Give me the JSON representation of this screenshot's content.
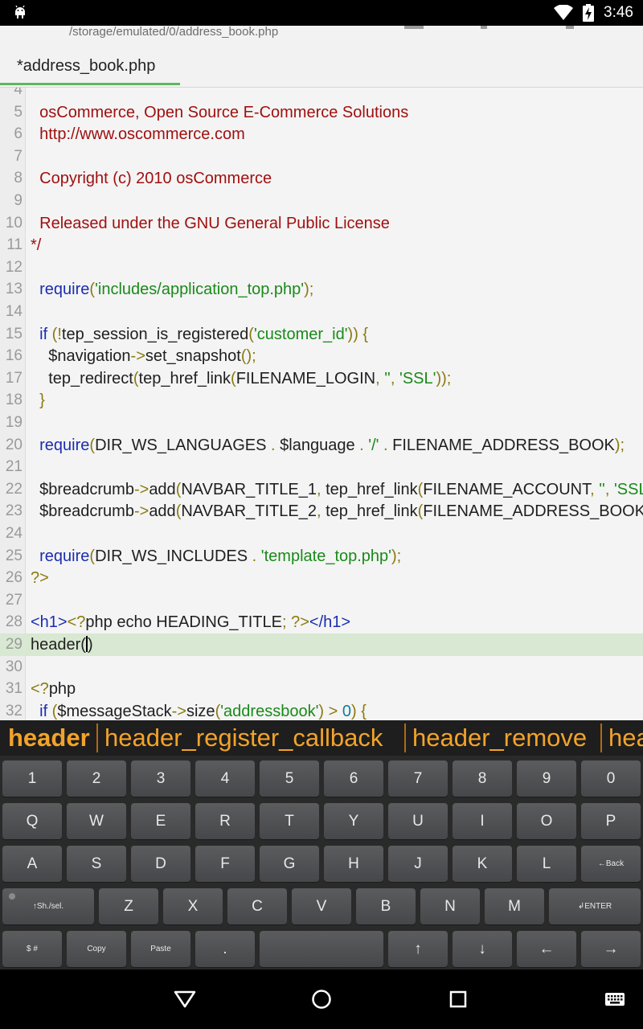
{
  "status_bar": {
    "time": "3:46",
    "icons": [
      "android-icon",
      "wifi-icon",
      "battery-charging-icon"
    ]
  },
  "app_bar": {
    "file_path": "/storage/emulated/0/address_book.php"
  },
  "tabs": [
    {
      "label": "*address_book.php",
      "active": true
    }
  ],
  "editor": {
    "current_line": 29,
    "lines": [
      {
        "n": "4",
        "parts": []
      },
      {
        "n": "5",
        "parts": [
          {
            "t": "  ",
            "c": ""
          },
          {
            "t": "osCommerce, Open Source E-Commerce Solutions",
            "c": "cmt"
          }
        ]
      },
      {
        "n": "6",
        "parts": [
          {
            "t": "  ",
            "c": ""
          },
          {
            "t": "http://www.oscommerce.com",
            "c": "cmt"
          }
        ]
      },
      {
        "n": "7",
        "parts": []
      },
      {
        "n": "8",
        "parts": [
          {
            "t": "  ",
            "c": ""
          },
          {
            "t": "Copyright (c) 2010 osCommerce",
            "c": "cmt"
          }
        ]
      },
      {
        "n": "9",
        "parts": []
      },
      {
        "n": "10",
        "parts": [
          {
            "t": "  ",
            "c": ""
          },
          {
            "t": "Released under the GNU General Public License",
            "c": "cmt"
          }
        ]
      },
      {
        "n": "11",
        "parts": [
          {
            "t": "*/",
            "c": "cmt"
          }
        ]
      },
      {
        "n": "12",
        "parts": []
      },
      {
        "n": "13",
        "parts": [
          {
            "t": "  ",
            "c": ""
          },
          {
            "t": "require",
            "c": "kw"
          },
          {
            "t": "(",
            "c": "pun"
          },
          {
            "t": "'includes/application_top.php'",
            "c": "str"
          },
          {
            "t": ");",
            "c": "pun"
          }
        ]
      },
      {
        "n": "14",
        "parts": []
      },
      {
        "n": "15",
        "parts": [
          {
            "t": "  ",
            "c": ""
          },
          {
            "t": "if",
            "c": "kw"
          },
          {
            "t": " (!",
            "c": "pun"
          },
          {
            "t": "tep_session_is_registered",
            "c": ""
          },
          {
            "t": "(",
            "c": "pun"
          },
          {
            "t": "'customer_id'",
            "c": "str"
          },
          {
            "t": ")) {",
            "c": "pun"
          }
        ]
      },
      {
        "n": "16",
        "parts": [
          {
            "t": "    $navigation",
            "c": ""
          },
          {
            "t": "->",
            "c": "pun"
          },
          {
            "t": "set_snapshot",
            "c": ""
          },
          {
            "t": "();",
            "c": "pun"
          }
        ]
      },
      {
        "n": "17",
        "parts": [
          {
            "t": "    tep_redirect",
            "c": ""
          },
          {
            "t": "(",
            "c": "pun"
          },
          {
            "t": "tep_href_link",
            "c": ""
          },
          {
            "t": "(",
            "c": "pun"
          },
          {
            "t": "FILENAME_LOGIN",
            "c": ""
          },
          {
            "t": ", ",
            "c": "pun"
          },
          {
            "t": "''",
            "c": "str"
          },
          {
            "t": ", ",
            "c": "pun"
          },
          {
            "t": "'SSL'",
            "c": "str"
          },
          {
            "t": "));",
            "c": "pun"
          }
        ]
      },
      {
        "n": "18",
        "parts": [
          {
            "t": "  ",
            "c": ""
          },
          {
            "t": "}",
            "c": "pun"
          }
        ]
      },
      {
        "n": "19",
        "parts": []
      },
      {
        "n": "20",
        "parts": [
          {
            "t": "  ",
            "c": ""
          },
          {
            "t": "require",
            "c": "kw"
          },
          {
            "t": "(",
            "c": "pun"
          },
          {
            "t": "DIR_WS_LANGUAGES ",
            "c": ""
          },
          {
            "t": ". ",
            "c": "pun"
          },
          {
            "t": "$language ",
            "c": ""
          },
          {
            "t": ". ",
            "c": "pun"
          },
          {
            "t": "'/'",
            "c": "str"
          },
          {
            "t": " . ",
            "c": "pun"
          },
          {
            "t": "FILENAME_ADDRESS_BOOK",
            "c": ""
          },
          {
            "t": ");",
            "c": "pun"
          }
        ]
      },
      {
        "n": "21",
        "parts": []
      },
      {
        "n": "22",
        "parts": [
          {
            "t": "  $breadcrumb",
            "c": ""
          },
          {
            "t": "->",
            "c": "pun"
          },
          {
            "t": "add",
            "c": ""
          },
          {
            "t": "(",
            "c": "pun"
          },
          {
            "t": "NAVBAR_TITLE_1",
            "c": ""
          },
          {
            "t": ", ",
            "c": "pun"
          },
          {
            "t": "tep_href_link",
            "c": ""
          },
          {
            "t": "(",
            "c": "pun"
          },
          {
            "t": "FILENAME_ACCOUNT",
            "c": ""
          },
          {
            "t": ", ",
            "c": "pun"
          },
          {
            "t": "''",
            "c": "str"
          },
          {
            "t": ", ",
            "c": "pun"
          },
          {
            "t": "'SSL'",
            "c": "str"
          }
        ]
      },
      {
        "n": "23",
        "parts": [
          {
            "t": "  $breadcrumb",
            "c": ""
          },
          {
            "t": "->",
            "c": "pun"
          },
          {
            "t": "add",
            "c": ""
          },
          {
            "t": "(",
            "c": "pun"
          },
          {
            "t": "NAVBAR_TITLE_2",
            "c": ""
          },
          {
            "t": ", ",
            "c": "pun"
          },
          {
            "t": "tep_href_link",
            "c": ""
          },
          {
            "t": "(",
            "c": "pun"
          },
          {
            "t": "FILENAME_ADDRESS_BOOK",
            "c": ""
          },
          {
            "t": ",",
            "c": "pun"
          }
        ]
      },
      {
        "n": "24",
        "parts": []
      },
      {
        "n": "25",
        "parts": [
          {
            "t": "  ",
            "c": ""
          },
          {
            "t": "require",
            "c": "kw"
          },
          {
            "t": "(",
            "c": "pun"
          },
          {
            "t": "DIR_WS_INCLUDES ",
            "c": ""
          },
          {
            "t": ". ",
            "c": "pun"
          },
          {
            "t": "'template_top.php'",
            "c": "str"
          },
          {
            "t": ");",
            "c": "pun"
          }
        ]
      },
      {
        "n": "26",
        "parts": [
          {
            "t": "?>",
            "c": "php"
          }
        ]
      },
      {
        "n": "27",
        "parts": []
      },
      {
        "n": "28",
        "parts": [
          {
            "t": "<h1>",
            "c": "tag"
          },
          {
            "t": "<?",
            "c": "php"
          },
          {
            "t": "php echo HEADING_TITLE",
            "c": ""
          },
          {
            "t": "; ",
            "c": "pun"
          },
          {
            "t": "?>",
            "c": "php"
          },
          {
            "t": "</h1>",
            "c": "tag"
          }
        ]
      },
      {
        "n": "29",
        "parts": [
          {
            "t": "header(",
            "c": ""
          },
          {
            "t": "|",
            "c": "cursor"
          },
          {
            "t": ")",
            "c": ""
          }
        ]
      },
      {
        "n": "30",
        "parts": []
      },
      {
        "n": "31",
        "parts": [
          {
            "t": "<?",
            "c": "php"
          },
          {
            "t": "php",
            "c": ""
          }
        ]
      },
      {
        "n": "32",
        "parts": [
          {
            "t": "  ",
            "c": ""
          },
          {
            "t": "if",
            "c": "kw"
          },
          {
            "t": " (",
            "c": "pun"
          },
          {
            "t": "$messageStack",
            "c": ""
          },
          {
            "t": "->",
            "c": "pun"
          },
          {
            "t": "size",
            "c": ""
          },
          {
            "t": "(",
            "c": "pun"
          },
          {
            "t": "'addressbook'",
            "c": "str"
          },
          {
            "t": ") > ",
            "c": "pun"
          },
          {
            "t": "0",
            "c": "num"
          },
          {
            "t": ") {",
            "c": "pun"
          }
        ]
      }
    ]
  },
  "suggestions": [
    "header",
    "header_register_callback",
    "header_remove",
    "hea"
  ],
  "keyboard": {
    "row1": [
      "1",
      "2",
      "3",
      "4",
      "5",
      "6",
      "7",
      "8",
      "9",
      "0"
    ],
    "row2": [
      "Q",
      "W",
      "E",
      "R",
      "T",
      "Y",
      "U",
      "I",
      "O",
      "P"
    ],
    "row3": [
      "A",
      "S",
      "D",
      "F",
      "G",
      "H",
      "J",
      "K",
      "L",
      "←Back"
    ],
    "row4": [
      "↑Sh./sel.",
      "Z",
      "X",
      "C",
      "V",
      "B",
      "N",
      "M",
      "↲ENTER"
    ],
    "row5": [
      "$ #",
      "Copy",
      "Paste",
      ".",
      "",
      "↑",
      "↓",
      "←",
      "→"
    ]
  },
  "nav_bar": {
    "buttons": [
      "back-icon",
      "home-icon",
      "recents-icon",
      "keyboard-icon"
    ]
  },
  "colors": {
    "suggestion_text": "#f3a32a",
    "tab_underline": "#5cb85c",
    "current_line": "#d8e8d2"
  }
}
